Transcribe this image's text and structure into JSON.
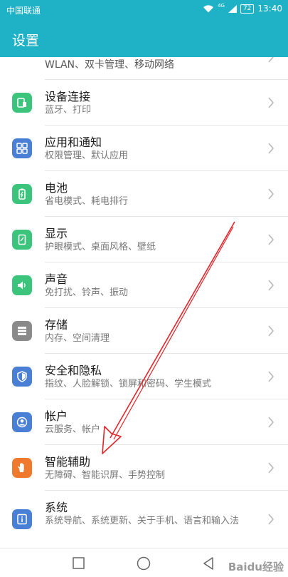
{
  "status_bar": {
    "carrier": "中国联通",
    "network": "4G",
    "battery": "72",
    "time": "13:40"
  },
  "header": {
    "title": "设置"
  },
  "settings": [
    {
      "label": "",
      "subtitle": "WLAN、双卡管理、移动网络",
      "icon": "network-icon",
      "color": "#4a7fd6"
    },
    {
      "label": "设备连接",
      "subtitle": "蓝牙、打印",
      "icon": "device-connection-icon",
      "color": "#3cc47c"
    },
    {
      "label": "应用和通知",
      "subtitle": "权限管理、默认应用",
      "icon": "apps-grid-icon",
      "color": "#4a7fd6"
    },
    {
      "label": "电池",
      "subtitle": "省电模式、耗电排行",
      "icon": "battery-icon",
      "color": "#3cc47c"
    },
    {
      "label": "显示",
      "subtitle": "护眼模式、桌面风格、壁纸",
      "icon": "display-icon",
      "color": "#3cc47c"
    },
    {
      "label": "声音",
      "subtitle": "免打扰、铃声、振动",
      "icon": "speaker-icon",
      "color": "#3cc47c"
    },
    {
      "label": "存储",
      "subtitle": "内存、空间清理",
      "icon": "storage-icon",
      "color": "#8a8a8a"
    },
    {
      "label": "安全和隐私",
      "subtitle": "指纹、人脸解锁、锁屏和密码、学生模式",
      "icon": "shield-icon",
      "color": "#4a7fd6"
    },
    {
      "label": "帐户",
      "subtitle": "云服务、帐户",
      "icon": "account-icon",
      "color": "#4a7fd6"
    },
    {
      "label": "智能辅助",
      "subtitle": "无障碍、智能识屏、手势控制",
      "icon": "hand-icon",
      "color": "#ef7a2e"
    },
    {
      "label": "系统",
      "subtitle": "系统导航、系统更新、关于手机、语言和输入法",
      "icon": "info-icon",
      "color": "#4a7fd6"
    }
  ],
  "colors": {
    "accent": "#1fb2c6",
    "annotation_arrow": "#e0252b"
  },
  "watermark": "Baidu经验"
}
